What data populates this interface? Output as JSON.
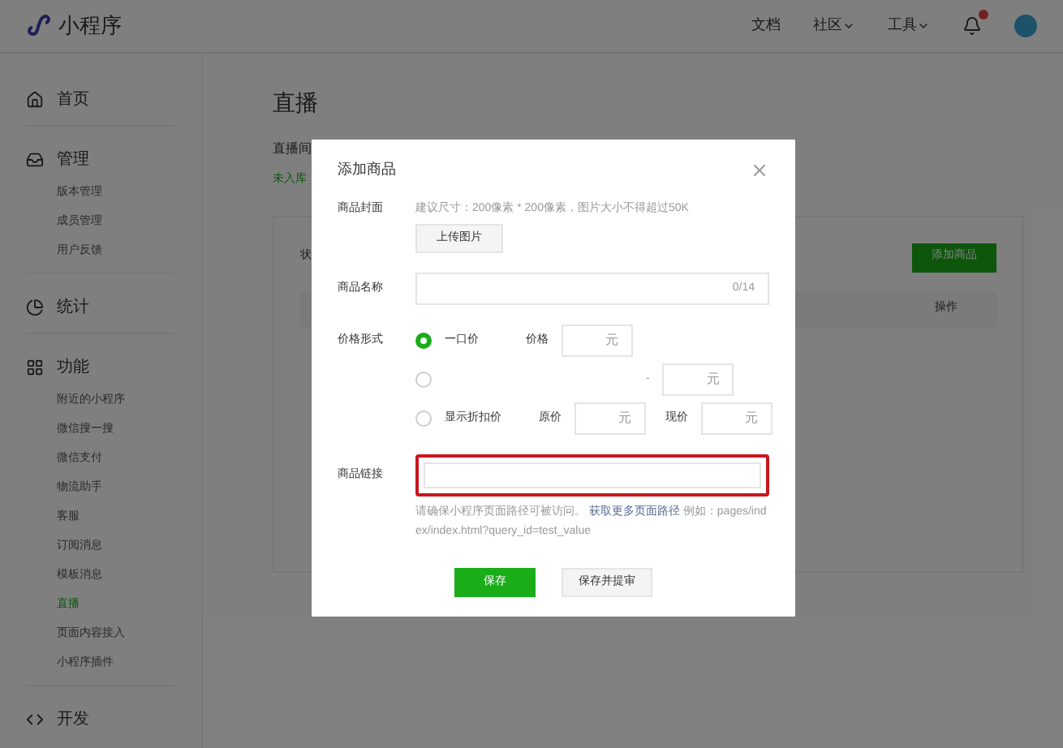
{
  "header": {
    "logo": "小程序",
    "links": [
      {
        "label": "文档",
        "dropdown": false
      },
      {
        "label": "社区",
        "dropdown": true
      },
      {
        "label": "工具",
        "dropdown": true
      }
    ],
    "notification_badge": true
  },
  "sidebar": {
    "groups": [
      {
        "label": "首页"
      },
      {
        "label": "管理",
        "items": [
          {
            "label": "版本管理",
            "selected": false
          },
          {
            "label": "成员管理",
            "selected": false
          },
          {
            "label": "用户反馈",
            "selected": false
          }
        ]
      },
      {
        "label": "统计"
      },
      {
        "label": "功能",
        "items": [
          {
            "label": "附近的小程序",
            "selected": false
          },
          {
            "label": "微信搜一搜",
            "selected": false
          },
          {
            "label": "微信支付",
            "selected": false
          },
          {
            "label": "物流助手",
            "selected": false
          },
          {
            "label": "客服",
            "selected": false
          },
          {
            "label": "订阅消息",
            "selected": false
          },
          {
            "label": "模板消息",
            "selected": false
          },
          {
            "label": "直播",
            "selected": true
          },
          {
            "label": "页面内容接入",
            "selected": false
          },
          {
            "label": "小程序插件",
            "selected": false
          }
        ]
      },
      {
        "label": "开发"
      }
    ]
  },
  "main": {
    "title": "直播",
    "subtitle": "直播间",
    "status_tab": "未入库",
    "filter_label": "状",
    "add_button": "添加商品",
    "column": "操作"
  },
  "dialog": {
    "title": "添加商品",
    "cover": {
      "label": "商品封面",
      "hint": "建议尺寸：200像素 * 200像素，图片大小不得超过50K",
      "button": "上传图片"
    },
    "name": {
      "label": "商品名称",
      "counter": "0/14"
    },
    "price": {
      "label": "价格形式",
      "options": [
        {
          "kind": "single",
          "selected": true,
          "option_label": "一口价",
          "fields": [
            {
              "label": "价格",
              "unit": "元"
            }
          ]
        },
        {
          "kind": "range",
          "selected": false,
          "separator": "-",
          "fields": [
            {
              "unit": "元"
            }
          ]
        },
        {
          "kind": "discount",
          "selected": false,
          "option_label": "显示折扣价",
          "fields": [
            {
              "label": "原价",
              "unit": "元"
            },
            {
              "label": "现价",
              "unit": "元"
            }
          ]
        }
      ]
    },
    "link": {
      "label": "商品链接",
      "highlighted": true,
      "help_before": "请确保小程序页面路径可被访问。",
      "help_link": "获取更多页面路径",
      "help_after": "例如：pages/index/index.html?query_id=test_value"
    },
    "buttons": [
      {
        "kind": "primary",
        "label": "保存"
      },
      {
        "kind": "secondary",
        "label": "保存并提审"
      }
    ]
  }
}
